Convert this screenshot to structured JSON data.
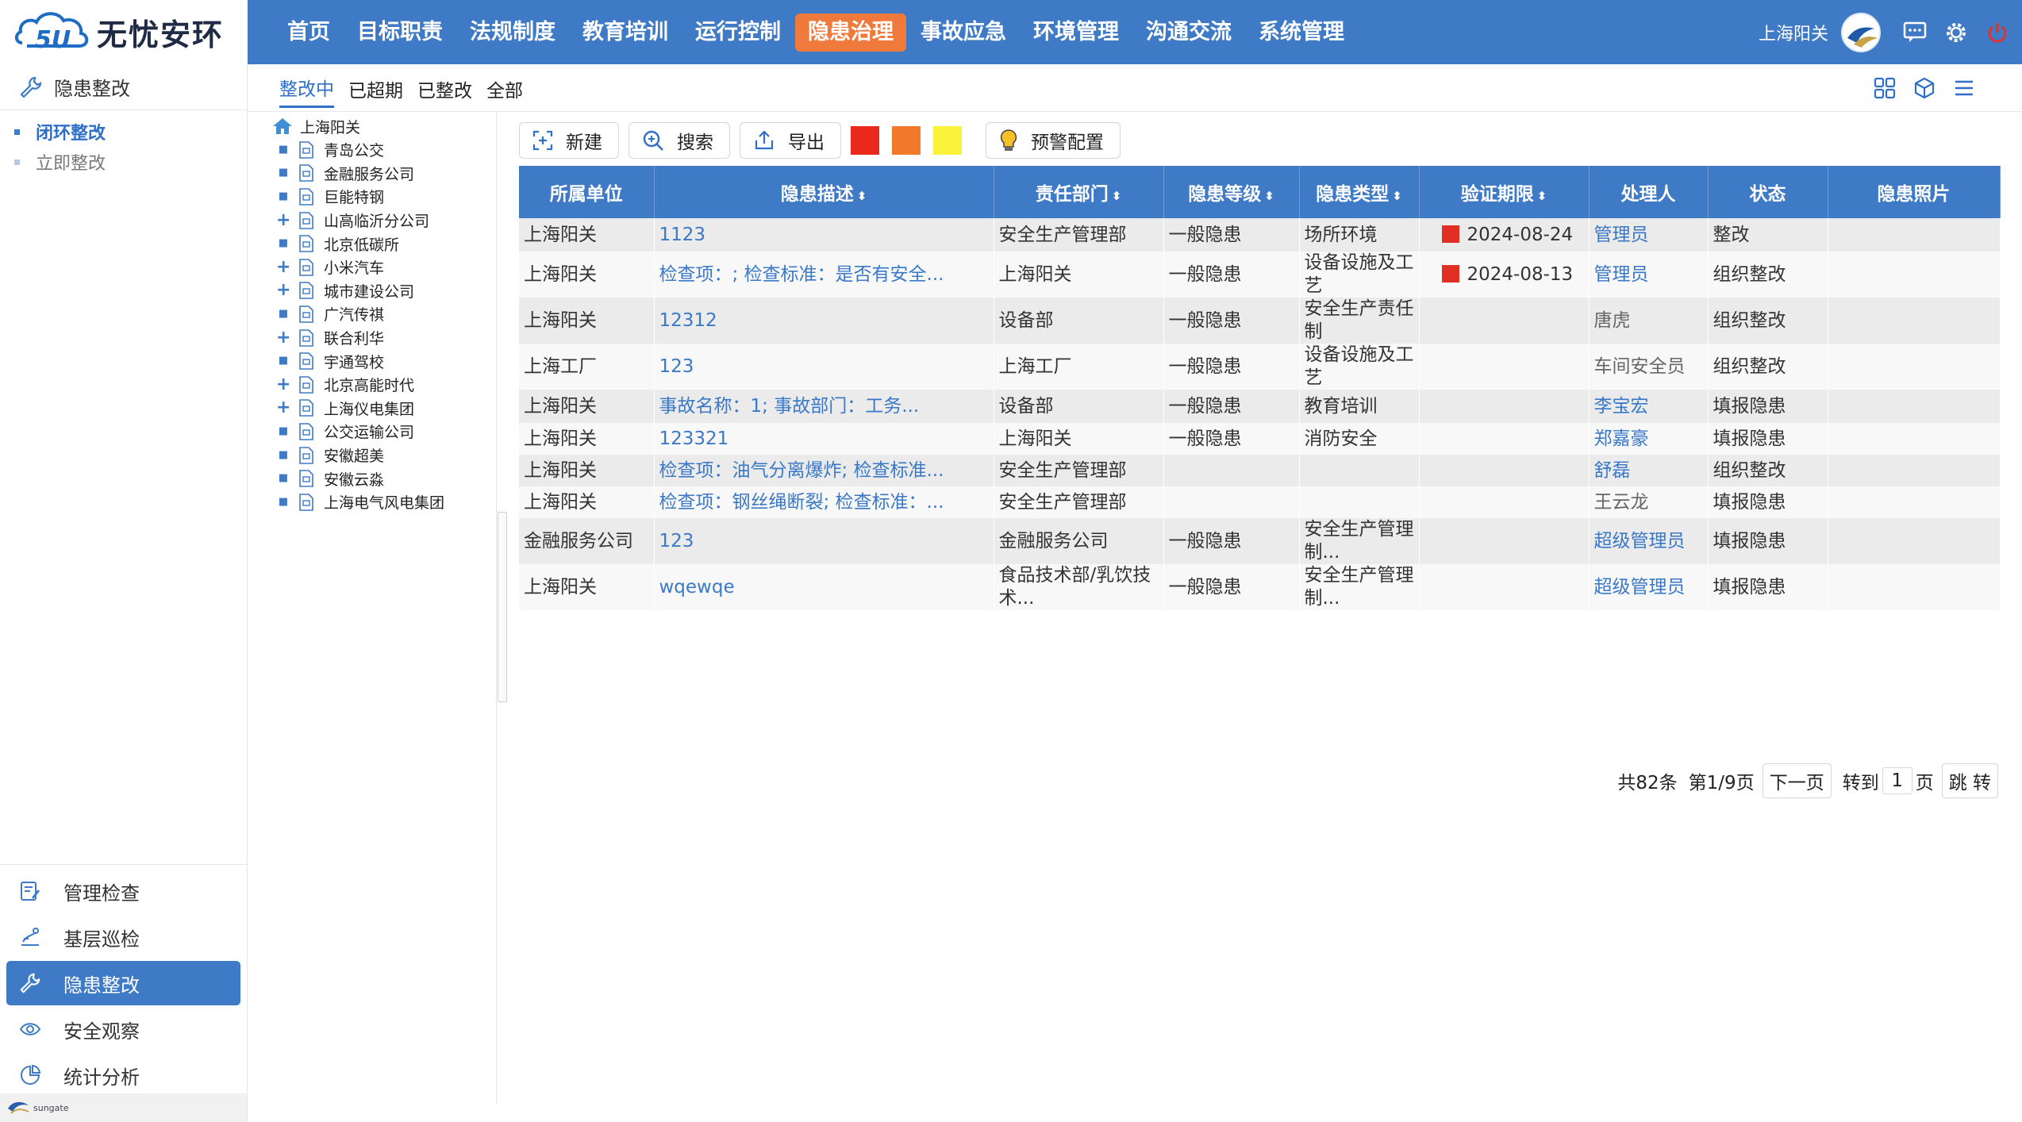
{
  "app": {
    "logo_text": "无忧安环",
    "brand_mark_text": "5U",
    "footer_logo": "sungate"
  },
  "nav": {
    "items": [
      {
        "label": "首页"
      },
      {
        "label": "目标职责"
      },
      {
        "label": "法规制度"
      },
      {
        "label": "教育培训"
      },
      {
        "label": "运行控制"
      },
      {
        "label": "隐患治理",
        "active": true
      },
      {
        "label": "事故应急"
      },
      {
        "label": "环境管理"
      },
      {
        "label": "沟通交流"
      },
      {
        "label": "系统管理"
      }
    ],
    "user": "上海阳关",
    "active_color": "#f07a3b",
    "bar_color": "#3f7ac6"
  },
  "sidebar": {
    "title": "隐患整改",
    "sub_items": [
      {
        "label": "闭环整改",
        "active": true
      },
      {
        "label": "立即整改",
        "active": false
      }
    ],
    "bottom_items": [
      {
        "label": "管理检查",
        "icon": "checklist-icon"
      },
      {
        "label": "基层巡检",
        "icon": "patrol-icon"
      },
      {
        "label": "隐患整改",
        "icon": "wrench-icon",
        "active": true
      },
      {
        "label": "安全观察",
        "icon": "eye-icon"
      },
      {
        "label": "统计分析",
        "icon": "pie-chart-icon"
      }
    ]
  },
  "tabs": [
    {
      "label": "整改中",
      "active": true
    },
    {
      "label": "已超期"
    },
    {
      "label": "已整改"
    },
    {
      "label": "全部"
    }
  ],
  "tree": {
    "root": "上海阳关",
    "nodes": [
      {
        "label": "青岛公交",
        "expandable": false
      },
      {
        "label": "金融服务公司",
        "expandable": false
      },
      {
        "label": "巨能特钢",
        "expandable": false
      },
      {
        "label": "山高临沂分公司",
        "expandable": true
      },
      {
        "label": "北京低碳所",
        "expandable": false
      },
      {
        "label": "小米汽车",
        "expandable": true
      },
      {
        "label": "城市建设公司",
        "expandable": true
      },
      {
        "label": "广汽传祺",
        "expandable": false
      },
      {
        "label": "联合利华",
        "expandable": true
      },
      {
        "label": "宇通驾校",
        "expandable": false
      },
      {
        "label": "北京高能时代",
        "expandable": true
      },
      {
        "label": "上海仪电集团",
        "expandable": true
      },
      {
        "label": "公交运输公司",
        "expandable": false
      },
      {
        "label": "安徽超美",
        "expandable": false
      },
      {
        "label": "安徽云淼",
        "expandable": false
      },
      {
        "label": "上海电气风电集团",
        "expandable": false
      }
    ]
  },
  "toolbar": {
    "new_label": "新建",
    "search_label": "搜索",
    "export_label": "导出",
    "warning_label": "预警配置",
    "swatches": [
      "#e8291c",
      "#f07a2a",
      "#fbf23c"
    ]
  },
  "table": {
    "columns": [
      {
        "label": "所属单位",
        "sortable": false
      },
      {
        "label": "隐患描述",
        "sortable": true
      },
      {
        "label": "责任部门",
        "sortable": true
      },
      {
        "label": "隐患等级",
        "sortable": true
      },
      {
        "label": "隐患类型",
        "sortable": true
      },
      {
        "label": "验证期限",
        "sortable": true
      },
      {
        "label": "处理人",
        "sortable": false
      },
      {
        "label": "状态",
        "sortable": false
      },
      {
        "label": "隐患照片",
        "sortable": false
      }
    ],
    "rows": [
      {
        "unit": "上海阳关",
        "desc": "1123",
        "dept": "安全生产管理部",
        "level": "一般隐患",
        "type": "场所环境",
        "deadline": "2024-08-24",
        "flag": true,
        "handler": "管理员",
        "handler_link": true,
        "status": "整改",
        "photo": ""
      },
      {
        "unit": "上海阳关",
        "desc": "检查项：; 检查标准：是否有安全...",
        "dept": "上海阳关",
        "level": "一般隐患",
        "type": "设备设施及工艺",
        "deadline": "2024-08-13",
        "flag": true,
        "handler": "管理员",
        "handler_link": true,
        "status": "组织整改",
        "photo": ""
      },
      {
        "unit": "上海阳关",
        "desc": "12312",
        "dept": "设备部",
        "level": "一般隐患",
        "type": "安全生产责任制",
        "deadline": "",
        "flag": false,
        "handler": "唐虎",
        "handler_link": false,
        "status": "组织整改",
        "photo": ""
      },
      {
        "unit": "上海工厂",
        "desc": "123",
        "dept": "上海工厂",
        "level": "一般隐患",
        "type": "设备设施及工艺",
        "deadline": "",
        "flag": false,
        "handler": "车间安全员",
        "handler_link": false,
        "status": "组织整改",
        "photo": ""
      },
      {
        "unit": "上海阳关",
        "desc": "事故名称：1; 事故部门：工务...",
        "dept": "设备部",
        "level": "一般隐患",
        "type": "教育培训",
        "deadline": "",
        "flag": false,
        "handler": "李宝宏",
        "handler_link": true,
        "status": "填报隐患",
        "photo": ""
      },
      {
        "unit": "上海阳关",
        "desc": "123321",
        "dept": "上海阳关",
        "level": "一般隐患",
        "type": "消防安全",
        "deadline": "",
        "flag": false,
        "handler": "郑嘉豪",
        "handler_link": true,
        "status": "填报隐患",
        "photo": ""
      },
      {
        "unit": "上海阳关",
        "desc": "检查项：油气分离爆炸; 检查标准...",
        "dept": "安全生产管理部",
        "level": "",
        "type": "",
        "deadline": "",
        "flag": false,
        "handler": "舒磊",
        "handler_link": true,
        "status": "组织整改",
        "photo": ""
      },
      {
        "unit": "上海阳关",
        "desc": "检查项：钢丝绳断裂; 检查标准：...",
        "dept": "安全生产管理部",
        "level": "",
        "type": "",
        "deadline": "",
        "flag": false,
        "handler": "王云龙",
        "handler_link": false,
        "status": "填报隐患",
        "photo": ""
      },
      {
        "unit": "金融服务公司",
        "desc": "123",
        "dept": "金融服务公司",
        "level": "一般隐患",
        "type": "安全生产管理制...",
        "deadline": "",
        "flag": false,
        "handler": "超级管理员",
        "handler_link": true,
        "status": "填报隐患",
        "photo": ""
      },
      {
        "unit": "上海阳关",
        "desc": "wqewqe",
        "dept": "食品技术部/乳饮技术...",
        "level": "一般隐患",
        "type": "安全生产管理制...",
        "deadline": "",
        "flag": false,
        "handler": "超级管理员",
        "handler_link": true,
        "status": "填报隐患",
        "photo": ""
      }
    ]
  },
  "pager": {
    "total": "共82条",
    "page_info": "第1/9页",
    "next": "下一页",
    "goto_prefix": "转到",
    "goto_value": "1",
    "goto_suffix": "页",
    "jump": "跳 转"
  }
}
